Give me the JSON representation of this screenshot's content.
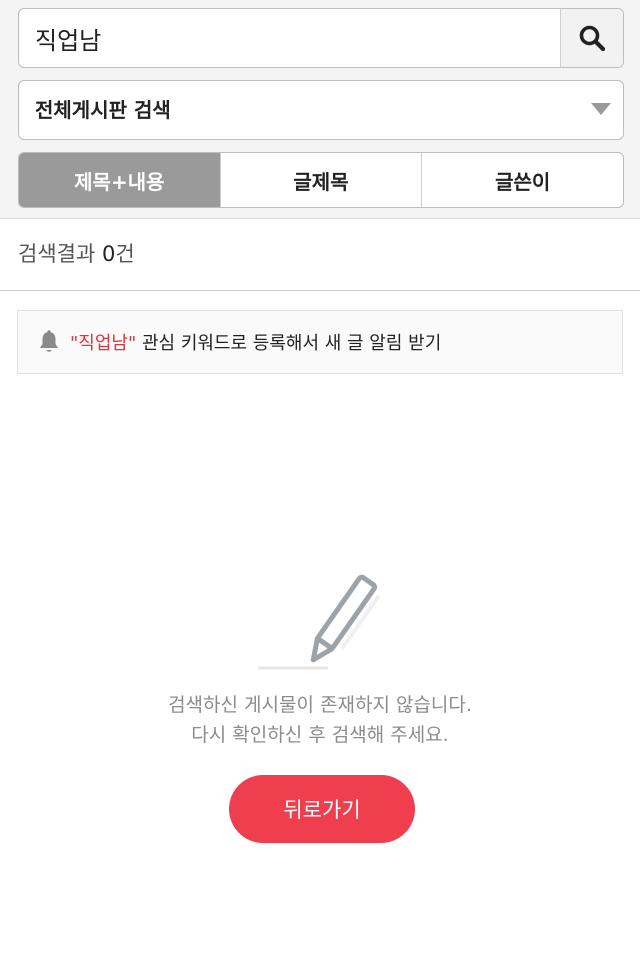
{
  "search": {
    "value": "직업남",
    "search_icon": "search-icon"
  },
  "scope": {
    "selected": "전체게시판 검색",
    "arrow_icon": "triangle-down-icon"
  },
  "tabs": [
    {
      "label": "제목+내용",
      "active": true
    },
    {
      "label": "글제목",
      "active": false
    },
    {
      "label": "글쓴이",
      "active": false
    }
  ],
  "results": {
    "prefix": "검색결과 ",
    "count": "0",
    "suffix": "건"
  },
  "keyword_banner": {
    "icon": "bell-icon",
    "keyword": "\"직업남\"",
    "text": " 관심 키워드로 등록해서 새 글 알림 받기"
  },
  "empty_state": {
    "icon": "pencil-icon",
    "line1": "검색하신 게시물이 존재하지 않습니다.",
    "line2": "다시 확인하신 후 검색해 주세요."
  },
  "back_button": {
    "label": "뒤로가기"
  },
  "colors": {
    "accent": "#ef3e4d",
    "keyword": "#e0343f",
    "active_tab": "#9a9a9a"
  }
}
